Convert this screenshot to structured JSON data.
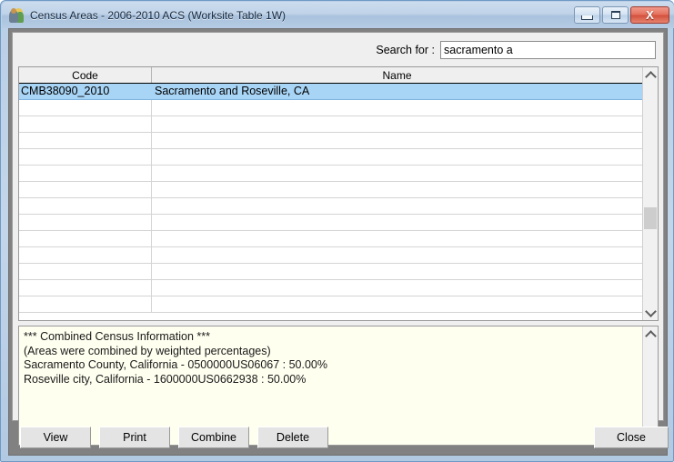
{
  "window": {
    "title": "Census Areas - 2006-2010 ACS (Worksite Table 1W)",
    "icon": "people-group-icon",
    "controls": {
      "minimize": "minimize-icon",
      "restore": "restore-icon",
      "close": "X"
    }
  },
  "search": {
    "label": "Search for :",
    "value": "sacramento a",
    "placeholder": ""
  },
  "list": {
    "columns": [
      "Code",
      "Name"
    ],
    "rows": [
      {
        "code": "CMB38090_2010",
        "name": "Sacramento and Roseville, CA",
        "selected": true
      },
      {
        "code": "",
        "name": "",
        "selected": false
      },
      {
        "code": "",
        "name": "",
        "selected": false
      },
      {
        "code": "",
        "name": "",
        "selected": false
      },
      {
        "code": "",
        "name": "",
        "selected": false
      },
      {
        "code": "",
        "name": "",
        "selected": false
      },
      {
        "code": "",
        "name": "",
        "selected": false
      },
      {
        "code": "",
        "name": "",
        "selected": false
      },
      {
        "code": "",
        "name": "",
        "selected": false
      },
      {
        "code": "",
        "name": "",
        "selected": false
      },
      {
        "code": "",
        "name": "",
        "selected": false
      },
      {
        "code": "",
        "name": "",
        "selected": false
      },
      {
        "code": "",
        "name": "",
        "selected": false
      },
      {
        "code": "",
        "name": "",
        "selected": false
      }
    ]
  },
  "info": {
    "text": "*** Combined Census Information ***\n(Areas were combined by weighted percentages)\nSacramento County, California - 0500000US06067 : 50.00%\nRoseville city, California - 1600000US0662938 : 50.00%",
    "lines": [
      "*** Combined Census Information ***",
      "(Areas were combined by weighted percentages)",
      "Sacramento County, California - 0500000US06067 : 50.00%",
      "Roseville city, California - 1600000US0662938 : 50.00%"
    ]
  },
  "buttons": {
    "view": "View",
    "print": "Print",
    "combine": "Combine",
    "delete": "Delete",
    "close": "Close"
  },
  "colors": {
    "selection": "#a8d4f5",
    "info_background": "#fffff0",
    "titlebar": "#c0d3e8",
    "close_button": "#d2503c",
    "client_background": "#efefef"
  }
}
